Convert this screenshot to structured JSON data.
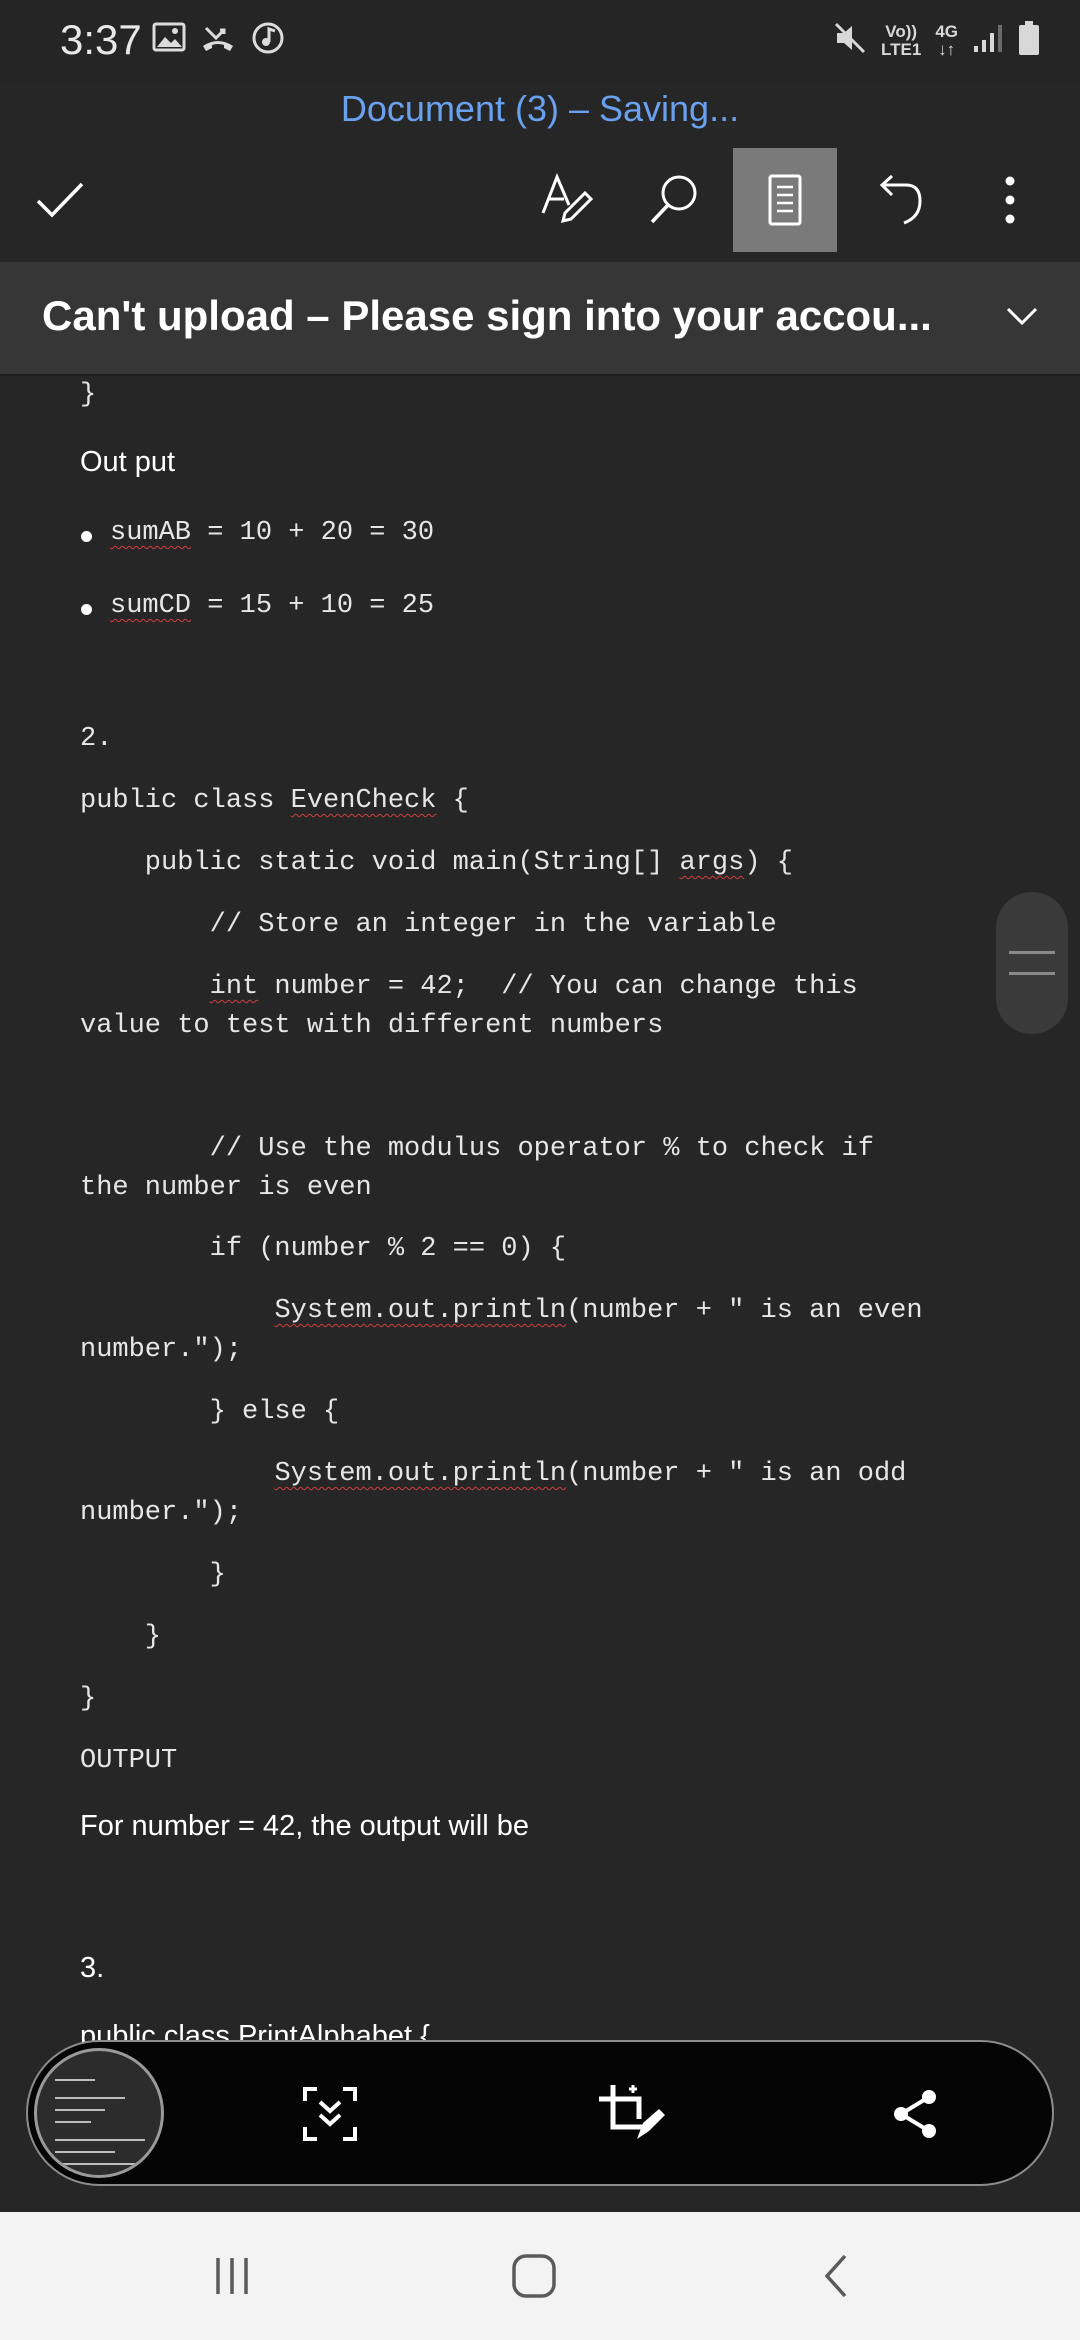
{
  "status_bar": {
    "time": "3:37",
    "network_top": "Vo))",
    "network_bottom": "LTE1",
    "network_type": "4G",
    "icons": [
      "gallery-icon",
      "missed-call-icon",
      "music-sync-icon",
      "mute-icon",
      "signal-icon",
      "battery-icon"
    ]
  },
  "header": {
    "title": "Document (3) – Saving..."
  },
  "toolbar": {
    "icons": [
      "check-icon",
      "pen-format-icon",
      "search-icon",
      "read-mode-icon",
      "undo-icon",
      "more-icon"
    ]
  },
  "banner": {
    "text": "Can't upload – Please sign into your accou..."
  },
  "document": {
    "brace_top": "}",
    "output_heading": "Out put",
    "bullets": [
      {
        "var": "sumAB",
        "rest": " = 10 + 20 = 30"
      },
      {
        "var": "sumCD",
        "rest": " = 15 + 10 = 25"
      }
    ],
    "num2": "2.",
    "l_class_a": "public class ",
    "l_class_b": "EvenCheck",
    "l_class_c": " {",
    "l_main_a": "    public static void main(String[] ",
    "l_main_b": "args",
    "l_main_c": ") {",
    "l_store": "        // Store an integer in the variable",
    "l_int_a": "        ",
    "l_int_b": "int",
    "l_int_c": " number = 42;  // You can change this",
    "l_int_d": "value to test with different numbers",
    "l_use_a": "        // Use the modulus operator % to check if",
    "l_use_b": "the number is even",
    "l_if": "        if (number % 2 == 0) {",
    "l_print1_a": "            ",
    "l_print1_b": "System.out.println",
    "l_print1_c": "(number + \" is an even",
    "l_print1_d": "number.\");",
    "l_else": "        } else {",
    "l_print2_a": "            ",
    "l_print2_b": "System.out.println",
    "l_print2_c": "(number + \" is an odd",
    "l_print2_d": "number.\");",
    "l_close1": "        }",
    "l_close2": "    }",
    "l_close3": "}",
    "output_label": "OUTPUT",
    "output_text": "For number = 42, the output will be",
    "num3": "3.",
    "partial": "public class PrintAlphabet {"
  },
  "capture_bar": {
    "icons": [
      "screenshot-thumbnail",
      "scroll-capture-icon",
      "crop-edit-icon",
      "share-icon"
    ]
  },
  "nav_bar": {
    "icons": [
      "recent-apps-icon",
      "home-icon",
      "back-icon"
    ]
  },
  "colors": {
    "background": "#262626",
    "title": "#6aa1ef",
    "banner": "#363636",
    "spell_underline": "#d04040",
    "nav_bar": "#f3f3f3"
  }
}
